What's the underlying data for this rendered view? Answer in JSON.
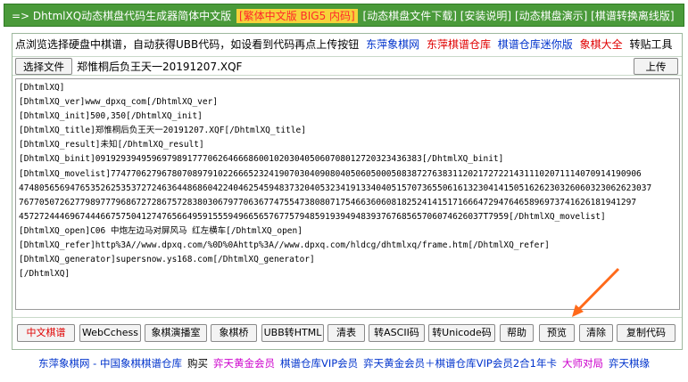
{
  "titlebar": {
    "prefix": "=> DhtmlXQ动态棋盘代码生成器简体中文版",
    "traditional_link": "[繁体中文版 BIG5 内码]",
    "links": [
      "[动态棋盘文件下载]",
      "[安装说明]",
      "[动态棋盘演示]",
      "[棋谱转换离线版]"
    ]
  },
  "toprow": {
    "instruction": "点浏览选择硬盘中棋谱，自动获得UBB代码，如设看到代码再点上传按钮",
    "links": [
      {
        "text": "东萍象棋网",
        "color": "#0033cc"
      },
      {
        "text": "东萍棋谱仓库",
        "color": "#e00000"
      },
      {
        "text": "棋谱仓库迷你版",
        "color": "#0033cc"
      },
      {
        "text": "象棋大全",
        "color": "#e00000"
      }
    ],
    "paste_tool": "转贴工具"
  },
  "filerow": {
    "choose_button": "选择文件",
    "filename": "郑惟桐后负王天一20191207.XQF",
    "upload_button": "上传"
  },
  "code_lines": [
    "[DhtmlXQ]",
    "[DhtmlXQ_ver]www_dpxq_com[/DhtmlXQ_ver]",
    "[DhtmlXQ_init]500,350[/DhtmlXQ_init]",
    "[DhtmlXQ_title]郑惟桐后负王天一20191207.XQF[/DhtmlXQ_title]",
    "[DhtmlXQ_result]未知[/DhtmlXQ_result]",
    "[DhtmlXQ_binit]0919293949596979891777062646668600102030405060708012720323436383[/DhtmlXQ_binit]",
    "[DhtmlXQ_movelist]77477062796780708979102266652324190703040908040506050005083872763831120217272214311102071114070914190906",
    "4748056569476535262535372724636448686042240462545948373204053234191334040515707365506161323041415051626230326060323062623037",
    "7677050726277989777968672728675728380306797706367747554738080717546636060818252414151716664729476465896973741626181941297",
    "4572724446967444667575041274765664959155594966565767757948591939494839376768565706074626037T7959[/DhtmlXQ_movelist]",
    "[DhtmlXQ_open]C06 中炮左边马对屏风马 红左横车[/DhtmlXQ_open]",
    "[DhtmlXQ_refer]http%3A//www.dpxq.com/%0D%0Ahttp%3A//www.dpxq.com/hldcg/dhtmlxq/frame.htm[/DhtmlXQ_refer]",
    "[DhtmlXQ_generator]supersnow.ys168.com[/DhtmlXQ_generator]",
    "[/DhtmlXQ]"
  ],
  "buttons": [
    "中文棋谱",
    "WebCchess",
    "象棋演播室",
    "象棋桥",
    "UBB转HTML",
    "清表",
    "转ASCII码",
    "转Unicode码",
    "帮助",
    "预览",
    "清除",
    "复制代码"
  ],
  "footer": [
    {
      "text": "东萍象棋网 - 中国象棋棋谱仓库",
      "color": "#0033cc"
    },
    {
      "text": "购买",
      "color": "#000000"
    },
    {
      "text": "弈天黄金会员",
      "color": "#cc00cc"
    },
    {
      "text": "棋谱仓库VIP会员",
      "color": "#0033cc"
    },
    {
      "text": "弈天黄金会员＋棋谱仓库VIP会员2合1年卡",
      "color": "#0033cc"
    },
    {
      "text": "大师对局",
      "color": "#cc00cc"
    },
    {
      "text": "弈天棋缘",
      "color": "#0033cc"
    }
  ],
  "colors": {
    "title_bg": "#4a9a3a",
    "accent": "#ff6a1a"
  }
}
